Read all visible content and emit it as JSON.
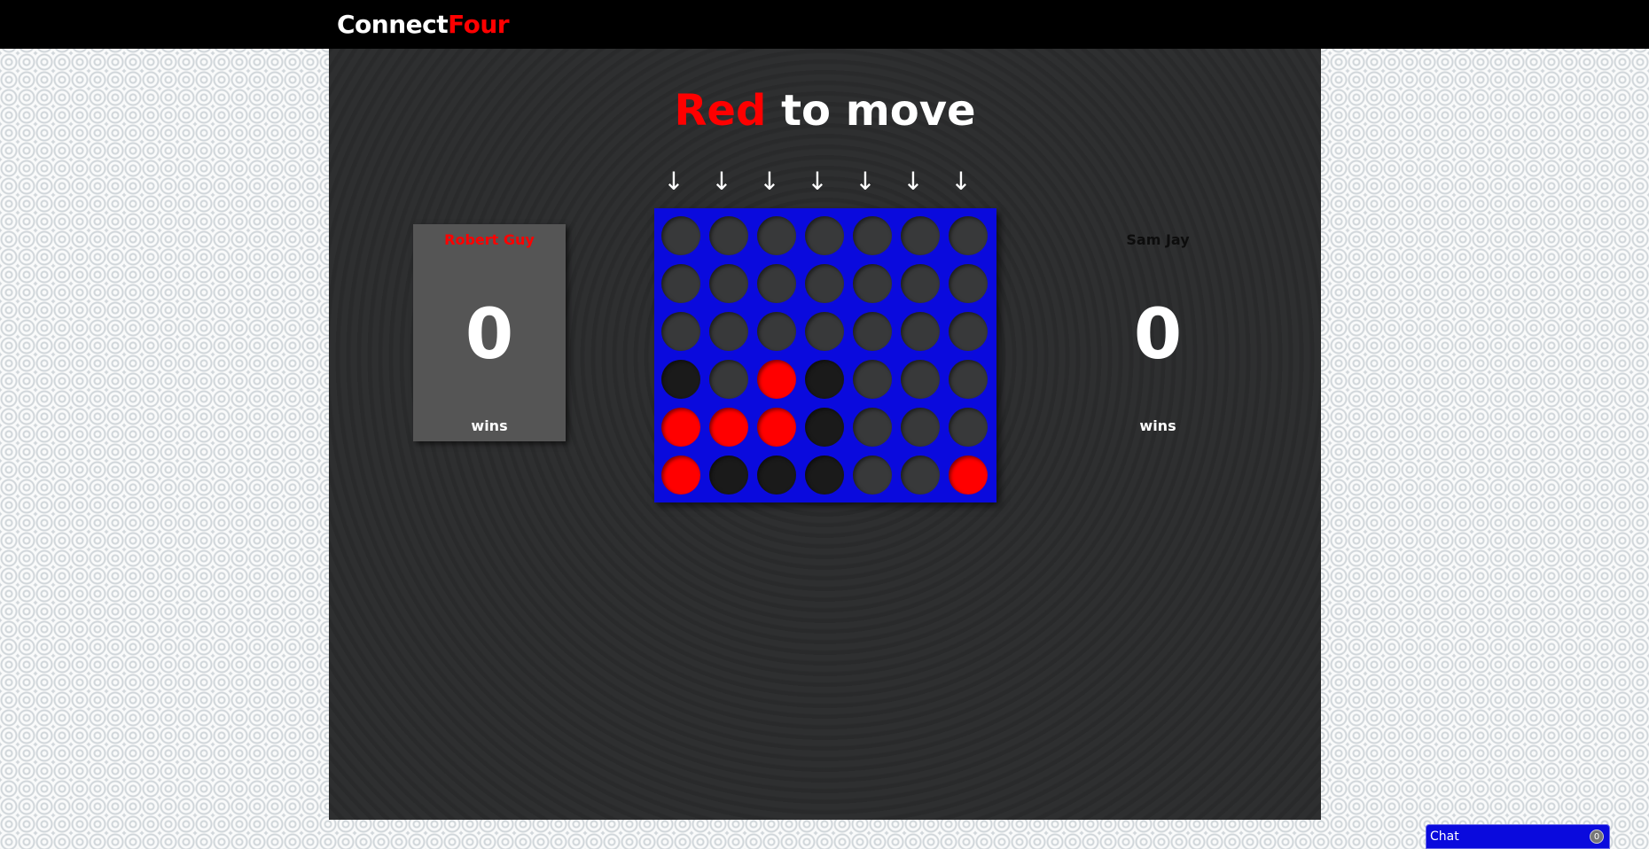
{
  "header": {
    "logo_part1": "Connect",
    "logo_part2": "Four"
  },
  "status": {
    "turn_color": "Red",
    "turn_text": "to move"
  },
  "arrows": [
    "↓",
    "↓",
    "↓",
    "↓",
    "↓",
    "↓",
    "↓"
  ],
  "board": {
    "columns": 7,
    "rows": 6,
    "cells": [
      [
        "empty",
        "empty",
        "empty",
        "empty",
        "empty",
        "empty",
        "empty"
      ],
      [
        "empty",
        "empty",
        "empty",
        "empty",
        "empty",
        "empty",
        "empty"
      ],
      [
        "empty",
        "empty",
        "empty",
        "empty",
        "empty",
        "empty",
        "empty"
      ],
      [
        "black",
        "empty",
        "red",
        "black",
        "empty",
        "empty",
        "empty"
      ],
      [
        "red",
        "red",
        "red",
        "black",
        "empty",
        "empty",
        "empty"
      ],
      [
        "red",
        "black",
        "black",
        "black",
        "empty",
        "empty",
        "red"
      ]
    ]
  },
  "player1": {
    "name": "Robert Guy",
    "score": "0",
    "label": "wins"
  },
  "player2": {
    "name": "Sam Jay",
    "score": "0",
    "label": "wins"
  },
  "chat": {
    "label": "Chat",
    "count": "0"
  },
  "colors": {
    "red": "#ff0000",
    "black": "#1a1a1a",
    "board": "#0a0add",
    "empty": "#38393a"
  }
}
